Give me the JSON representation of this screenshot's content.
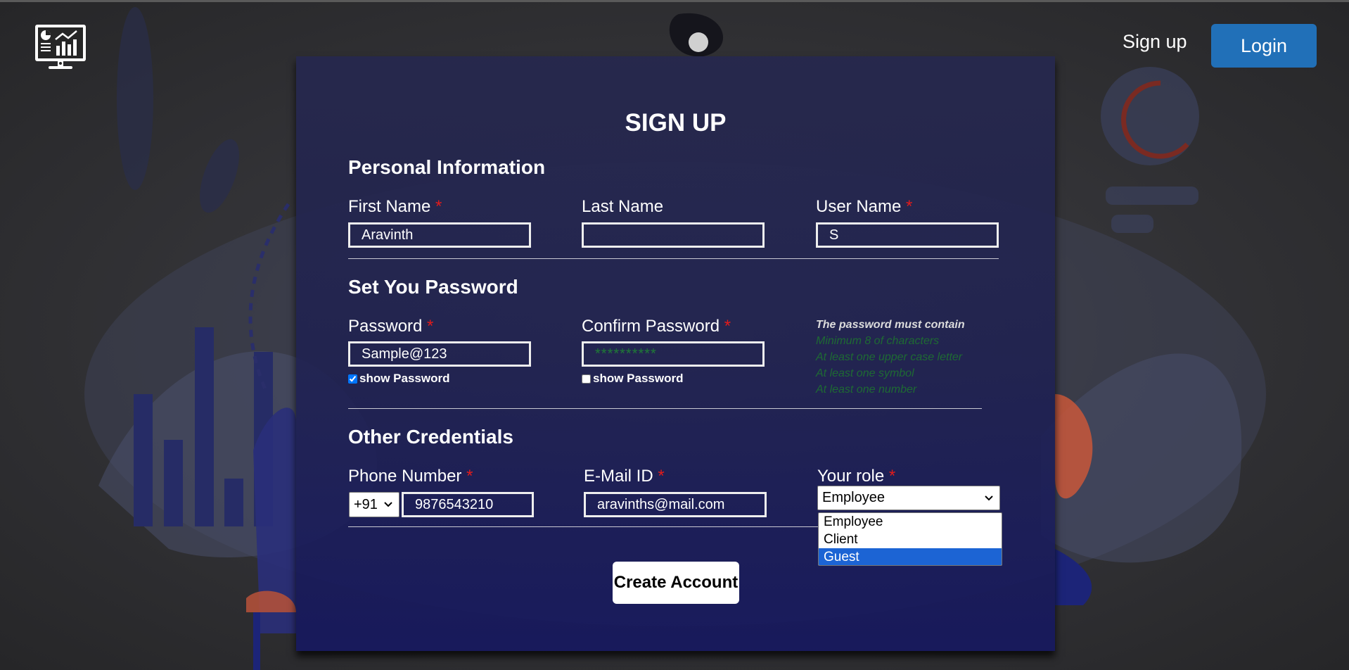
{
  "header": {
    "logo_icon": "monitor-charts-icon",
    "signup_label": "Sign up",
    "login_label": "Login",
    "accent": "#2170b8"
  },
  "form": {
    "title": "SIGN UP",
    "personal": {
      "title": "Personal Information",
      "first_name": {
        "label": "First Name",
        "required": "*",
        "value": "Aravinth"
      },
      "last_name": {
        "label": "Last Name",
        "value": ""
      },
      "user_name": {
        "label": "User Name",
        "required": "*",
        "value": "S"
      }
    },
    "password": {
      "title": "Set You Password",
      "password": {
        "label": "Password",
        "required": "*",
        "value": "Sample@123",
        "show_label": "show Password",
        "show_checked": true
      },
      "confirm": {
        "label": "Confirm Password",
        "required": "*",
        "value": "**********",
        "show_label": "show Password",
        "show_checked": false
      },
      "rules": {
        "heading": "The password must contain",
        "items": [
          "Minimum 8 of characters",
          "At least one upper case letter",
          "At least one symbol",
          "At least one number"
        ]
      }
    },
    "other": {
      "title": "Other Credentials",
      "phone": {
        "label": "Phone Number",
        "required": "*",
        "country_code": "+91",
        "value": "9876543210"
      },
      "email": {
        "label": "E-Mail ID",
        "required": "*",
        "value": "aravinths@mail.com"
      },
      "role": {
        "label": "Your role",
        "required": "*",
        "value": "Employee",
        "options": [
          "Employee",
          "Client",
          "Guest"
        ],
        "highlighted": "Guest"
      }
    },
    "submit_label": "Create Account"
  },
  "colors": {
    "required": "#e21b1b",
    "rule_text": "#1e6a33",
    "highlight": "#1c64d4"
  }
}
